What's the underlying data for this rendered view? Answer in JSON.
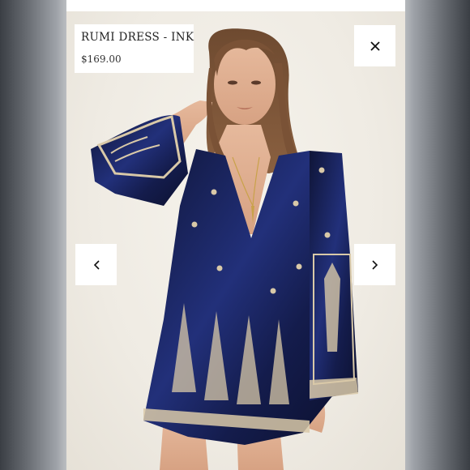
{
  "product": {
    "name": "RUMI DRESS - INK",
    "price": "$169.00"
  },
  "controls": {
    "close_icon": "close-icon",
    "prev_icon": "chevron-left-icon",
    "next_icon": "chevron-right-icon"
  },
  "colors": {
    "dress": "#1b2350",
    "embroidery": "#d9c9a8",
    "backdrop": "#efebe3"
  }
}
